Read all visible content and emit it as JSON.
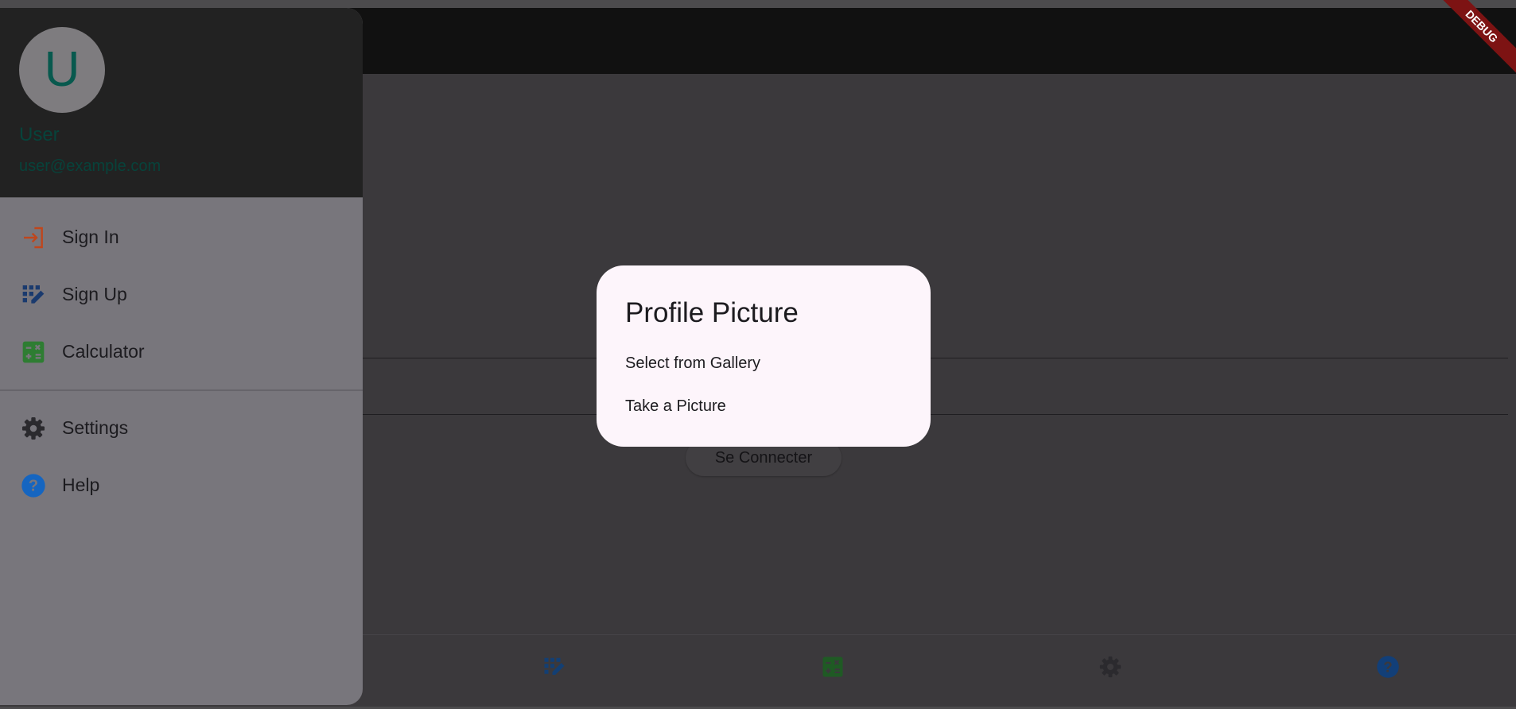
{
  "debug_banner": "DEBUG",
  "drawer": {
    "avatar_letter": "U",
    "user_name": "User",
    "user_email": "user@example.com",
    "items": [
      {
        "label": "Sign In",
        "icon": "login-icon"
      },
      {
        "label": "Sign Up",
        "icon": "app-registration-icon"
      },
      {
        "label": "Calculator",
        "icon": "calculator-icon"
      },
      {
        "label": "Settings",
        "icon": "gear-icon"
      },
      {
        "label": "Help",
        "icon": "help-icon"
      }
    ]
  },
  "main": {
    "connect_button": "Se Connecter"
  },
  "dialog": {
    "title": "Profile Picture",
    "options": [
      "Select from Gallery",
      "Take a Picture"
    ]
  },
  "bottom_nav": {
    "icons": [
      "app-registration-icon",
      "calculator-icon",
      "gear-icon",
      "help-icon"
    ]
  },
  "colors": {
    "sign_in_icon": "#c0461c",
    "sign_up_icon": "#1a3a6e",
    "calculator_icon": "#2e7d32",
    "settings_icon": "#2b2a2e",
    "help_icon": "#1565c0",
    "dialog_bg": "#fdf5fb"
  }
}
